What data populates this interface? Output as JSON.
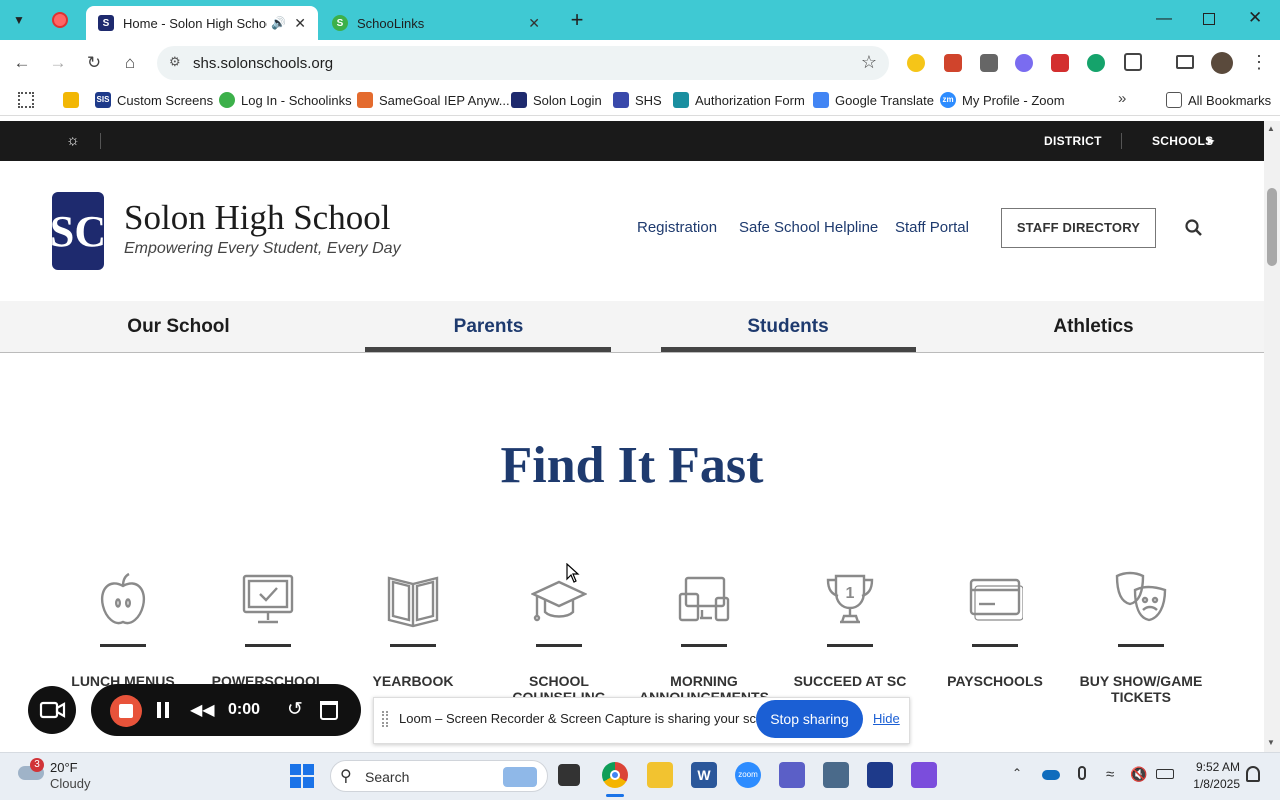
{
  "browser": {
    "tabs": [
      {
        "title": "Home - Solon High School",
        "active": true
      },
      {
        "title": "SchooLinks",
        "active": false
      }
    ],
    "url": "shs.solonschools.org",
    "bookmarks": [
      "Custom Screens",
      "Log In - Schoolinks",
      "SameGoal IEP Anyw...",
      "Solon Login",
      "SHS",
      "Authorization Form",
      "Google Translate",
      "My Profile - Zoom"
    ],
    "all_bookmarks": "All Bookmarks",
    "bookmark_icons": {
      "sis": "SIS",
      "zm": "zm"
    }
  },
  "site": {
    "topbar": {
      "district": "DISTRICT",
      "schools": "SCHOOLS"
    },
    "logo_letters": "SC",
    "name": "Solon High School",
    "tagline": "Empowering Every Student, Every Day",
    "header_links": [
      "Registration",
      "Safe School Helpline",
      "Staff Portal"
    ],
    "staff_directory": "STAFF DIRECTORY",
    "nav": [
      "Our School",
      "Parents",
      "Students",
      "Athletics"
    ],
    "find_it_fast": "Find It Fast",
    "quick_links": [
      {
        "l1": "LUNCH MENUS",
        "l2": "",
        "icon": "apple-icon"
      },
      {
        "l1": "POWERSCHOOL",
        "l2": "",
        "icon": "monitor-check-icon"
      },
      {
        "l1": "YEARBOOK",
        "l2": "",
        "icon": "book-icon"
      },
      {
        "l1": "SCHOOL",
        "l2": "COUNSELING",
        "icon": "graduation-cap-icon"
      },
      {
        "l1": "MORNING",
        "l2": "ANNOUNCEMENTS",
        "icon": "devices-icon"
      },
      {
        "l1": "SUCCEED AT SC",
        "l2": "",
        "icon": "trophy-icon"
      },
      {
        "l1": "PAYSCHOOLS",
        "l2": "",
        "icon": "credit-card-icon"
      },
      {
        "l1": "BUY SHOW/GAME",
        "l2": "TICKETS",
        "icon": "theater-masks-icon"
      }
    ]
  },
  "loom": {
    "timer": "0:00",
    "sharing_text": "Loom – Screen Recorder & Screen Capture is sharing your screen.",
    "stop_sharing": "Stop sharing",
    "hide": "Hide"
  },
  "taskbar": {
    "weather_temp": "20°F",
    "weather_desc": "Cloudy",
    "weather_badge": "3",
    "search": "Search",
    "time": "9:52 AM",
    "date": "1/8/2025",
    "zoom_icon_label": "zoom"
  }
}
